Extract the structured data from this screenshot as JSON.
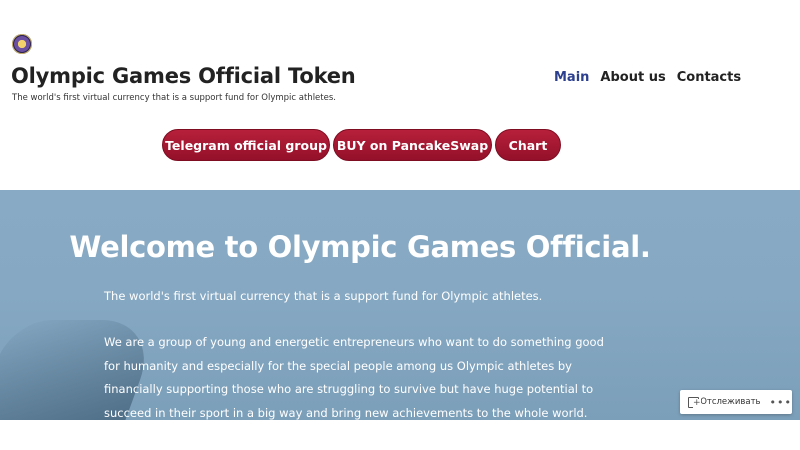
{
  "header": {
    "site_title": "Olympic Games Official Token",
    "tagline": "The world's first virtual currency that is a support fund for Olympic athletes.",
    "logo_icon": "olympic-emblem-icon"
  },
  "nav": {
    "items": [
      {
        "label": "Main",
        "active": true
      },
      {
        "label": "About us",
        "active": false
      },
      {
        "label": "Contacts",
        "active": false
      }
    ]
  },
  "buttons": {
    "telegram": "Telegram official group",
    "pancakeswap": "BUY on PancakeSwap",
    "chart": "Chart"
  },
  "hero": {
    "title": "Welcome to Olympic Games Official.",
    "paragraph1": "The world's first virtual currency that is a support fund for Olympic athletes.",
    "paragraph2_lines": [
      "We are a group of young and energetic entrepreneurs who want to do something good",
      "for humanity and especially for the special people among us Olympic athletes by",
      "financially supporting those who are struggling to survive but have huge potential to",
      "succeed in their sport in a big way and bring new achievements to the whole world."
    ]
  },
  "follow_widget": {
    "label": "Отслеживать",
    "icon": "follow-plus-icon",
    "more_icon": "more-dots-icon"
  },
  "colors": {
    "button_red": "#a8182f",
    "nav_active": "#2c3f8f",
    "hero_bg": "#86a8c2",
    "text_dark": "#222222"
  }
}
